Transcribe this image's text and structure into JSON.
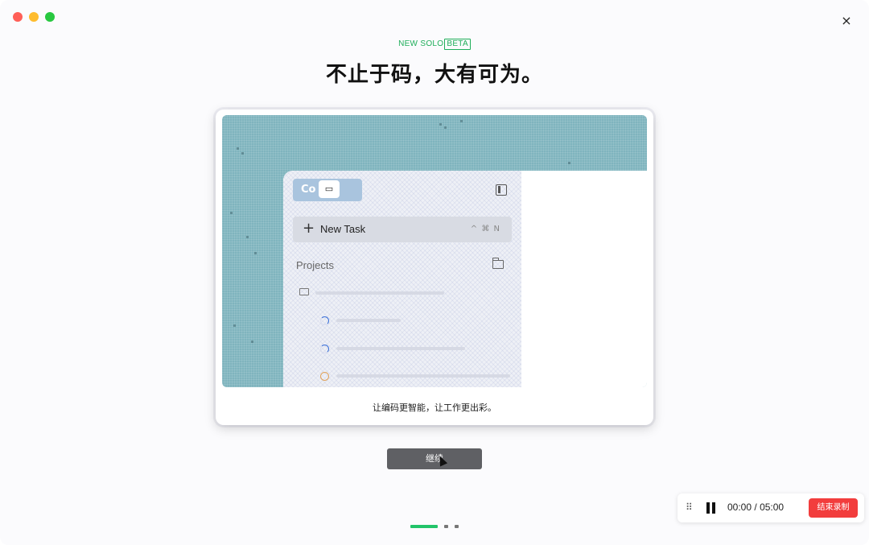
{
  "window": {
    "controls": [
      "close",
      "minimize",
      "zoom"
    ],
    "close_icon": "×"
  },
  "header": {
    "eyebrow_prefix": "NEW SOLO",
    "eyebrow_badge": "BETA",
    "headline": "不止于码，大有可为。"
  },
  "preview": {
    "logo_text": "Co",
    "logo_badge": "▭",
    "new_task_label": "New Task",
    "new_task_shortcut": "^ ⌘ N",
    "projects_label": "Projects"
  },
  "card": {
    "caption": "让编码更智能，让工作更出彩。"
  },
  "continue_button": "继续",
  "recorder": {
    "grip_icon": "⠿",
    "elapsed": "00:00",
    "separator": "/",
    "limit": "05:00",
    "stop_label": "结束录制"
  },
  "colors": {
    "accent_green": "#1fae5a",
    "stop_red": "#f23d3d",
    "preview_bg": "#7fb4be"
  }
}
